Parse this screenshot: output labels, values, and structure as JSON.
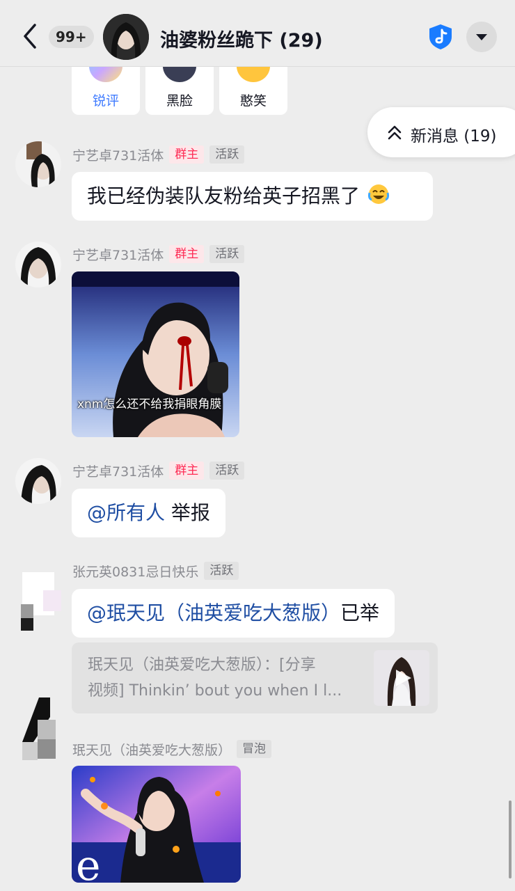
{
  "header": {
    "unread_badge": "99+",
    "title": "油婆粉丝跪下 (29)"
  },
  "stickers": [
    {
      "label": "锐评",
      "highlight": true
    },
    {
      "label": "黑脸",
      "highlight": false
    },
    {
      "label": "憨笑",
      "highlight": false
    }
  ],
  "new_messages": "新消息 (19)",
  "messages": [
    {
      "sender": "宁艺卓731活体",
      "tags": [
        "群主",
        "活跃"
      ],
      "text": "我已经伪装队友粉给英子招黑了"
    },
    {
      "sender": "宁艺卓731活体",
      "tags": [
        "群主",
        "活跃"
      ],
      "image_caption": "xnm怎么还不给我捐眼角膜"
    },
    {
      "sender": "宁艺卓731活体",
      "tags": [
        "群主",
        "活跃"
      ],
      "mention": "@所有人",
      "text": " 举报"
    },
    {
      "sender": "张元英0831忌日快乐",
      "tags": [
        "活跃"
      ],
      "mention": "@珉天见（油英爱吃大葱版）",
      "text": "已举",
      "quote_lines": [
        "珉天见（油英爱吃大葱版）：[分享",
        "视频] Thinkin’ bout you when I l..."
      ]
    },
    {
      "sender": "珉天见（油英爱吃大葱版）",
      "tags": [
        "冒泡"
      ]
    }
  ],
  "colors": {
    "background": "#ededed",
    "owner_tag": "#fe2c55",
    "mention": "#1f4ea3",
    "shield": "#1a7cff"
  }
}
